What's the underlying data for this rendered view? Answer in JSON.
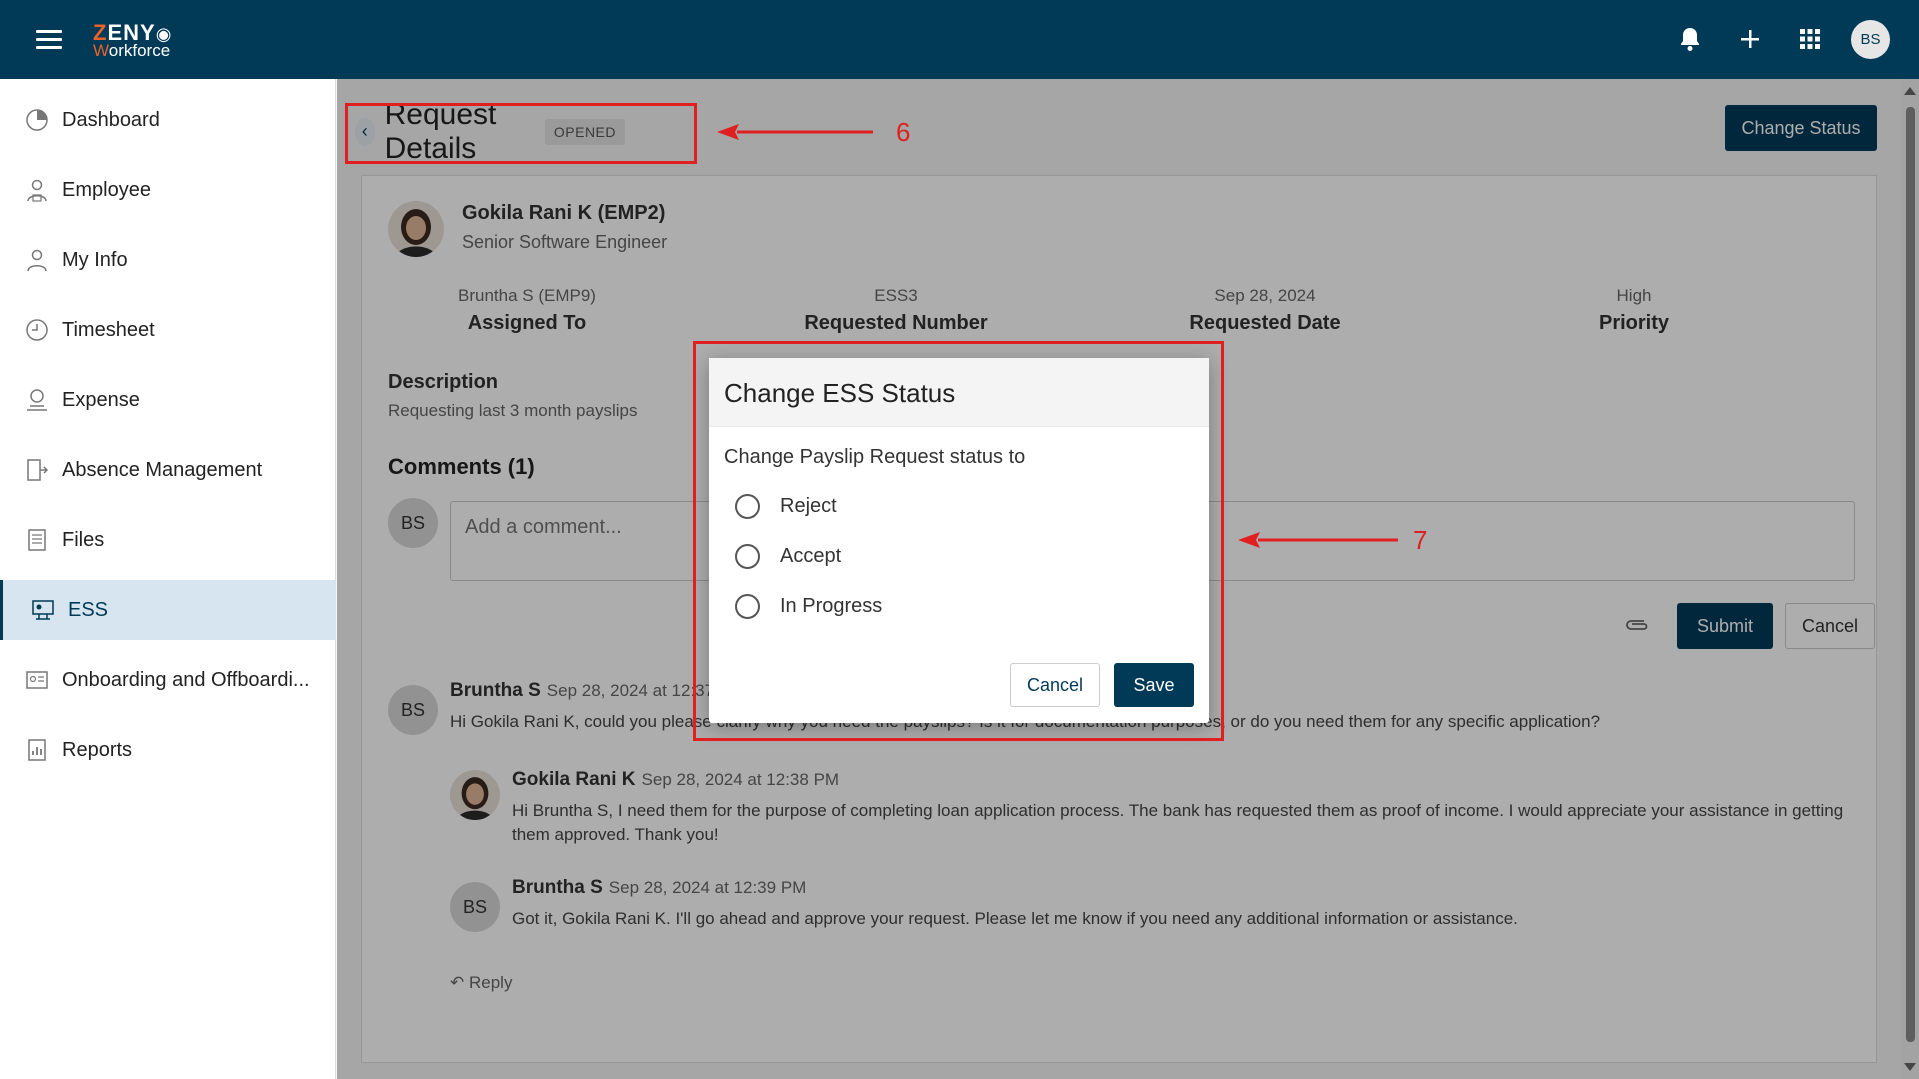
{
  "app": {
    "brand_top": "ZENY",
    "brand_bottom": "Workforce",
    "user_initials": "BS"
  },
  "sidebar": {
    "items": [
      {
        "label": "Dashboard",
        "icon": "dashboard-icon"
      },
      {
        "label": "Employee",
        "icon": "employee-icon"
      },
      {
        "label": "My Info",
        "icon": "my-info-icon"
      },
      {
        "label": "Timesheet",
        "icon": "clock-icon"
      },
      {
        "label": "Expense",
        "icon": "expense-icon"
      },
      {
        "label": "Absence Management",
        "icon": "door-exit-icon"
      },
      {
        "label": "Files",
        "icon": "file-icon"
      },
      {
        "label": "ESS",
        "icon": "ess-icon",
        "active": true
      },
      {
        "label": "Onboarding and Offboardi...",
        "icon": "id-card-icon"
      },
      {
        "label": "Reports",
        "icon": "report-icon"
      }
    ]
  },
  "header": {
    "title": "Request Details",
    "status": "OPENED",
    "change_status_label": "Change Status"
  },
  "employee": {
    "name": "Gokila Rani K (EMP2)",
    "role": "Senior Software Engineer"
  },
  "info": [
    {
      "value": "Bruntha S (EMP9)",
      "label": "Assigned To"
    },
    {
      "value": "ESS3",
      "label": "Requested Number"
    },
    {
      "value": "Sep 28, 2024",
      "label": "Requested Date"
    },
    {
      "value": "High",
      "label": "Priority"
    }
  ],
  "description": {
    "title": "Description",
    "text": "Requesting last 3 month payslips"
  },
  "comments": {
    "title": "Comments (1)",
    "input_placeholder": "Add a comment...",
    "submit_label": "Submit",
    "cancel_label": "Cancel",
    "reply_label": "Reply",
    "list": [
      {
        "initials": "BS",
        "author": "Bruntha S",
        "time": "Sep 28, 2024 at 12:37",
        "text": "Hi Gokila Rani K, could you please clarify why you need the payslips? Is it for documentation purposes, or do you need them for any specific application?"
      },
      {
        "initials": "",
        "author": "Gokila Rani K",
        "time": "Sep 28, 2024 at 12:38 PM",
        "text": "Hi Bruntha S, I need them for the purpose of completing loan application process. The bank has requested them as proof of income. I would appreciate your assistance in getting them approved. Thank you!"
      },
      {
        "initials": "BS",
        "author": "Bruntha S",
        "time": "Sep 28, 2024 at 12:39 PM",
        "text": "Got it, Gokila Rani K. I'll go ahead and approve your request. Please let me know if you need any additional information or assistance."
      }
    ]
  },
  "dialog": {
    "title": "Change ESS Status",
    "prompt": "Change Payslip Request status to",
    "options": [
      "Reject",
      "Accept",
      "In Progress"
    ],
    "cancel_label": "Cancel",
    "save_label": "Save"
  },
  "annotations": {
    "marker_6": "6",
    "marker_7": "7",
    "color": "#e02020"
  },
  "colors": {
    "primary": "#003a57",
    "active_nav_bg": "#d7e5f0"
  }
}
